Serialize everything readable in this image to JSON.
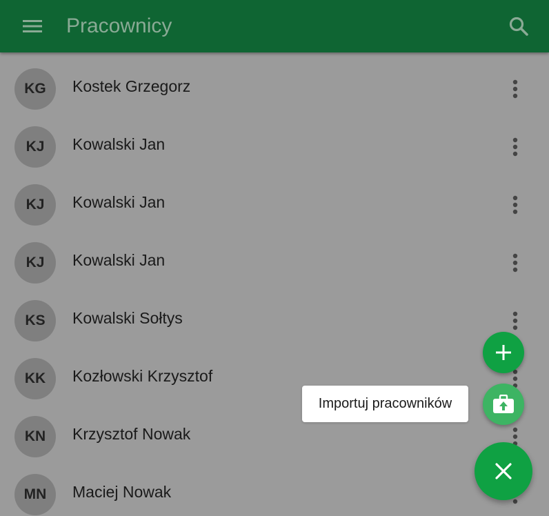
{
  "colors": {
    "app_bar": "#0f6533",
    "title_text": "#8aaa95",
    "background_scrim": "#9b9b9b",
    "avatar_bg": "#7f7f7f",
    "fab_green": "#0fa143",
    "fab_import_green": "#3db463"
  },
  "appbar": {
    "title": "Pracownicy",
    "menu_icon": "hamburger-menu-icon",
    "search_icon": "search-icon"
  },
  "employees": [
    {
      "initials": "KG",
      "name": "Kostek Grzegorz"
    },
    {
      "initials": "KJ",
      "name": "Kowalski Jan"
    },
    {
      "initials": "KJ",
      "name": "Kowalski Jan"
    },
    {
      "initials": "KJ",
      "name": "Kowalski Jan"
    },
    {
      "initials": "KS",
      "name": "Kowalski Sołtys"
    },
    {
      "initials": "KK",
      "name": "Kozłowski Krzysztof"
    },
    {
      "initials": "KN",
      "name": "Krzysztof Nowak"
    },
    {
      "initials": "MN",
      "name": "Maciej Nowak"
    }
  ],
  "row_menu_icon": "more-vertical-icon",
  "fab": {
    "add_icon": "plus-icon",
    "import_icon": "briefcase-upload-icon",
    "import_label": "Importuj pracowników",
    "close_icon": "close-icon"
  }
}
